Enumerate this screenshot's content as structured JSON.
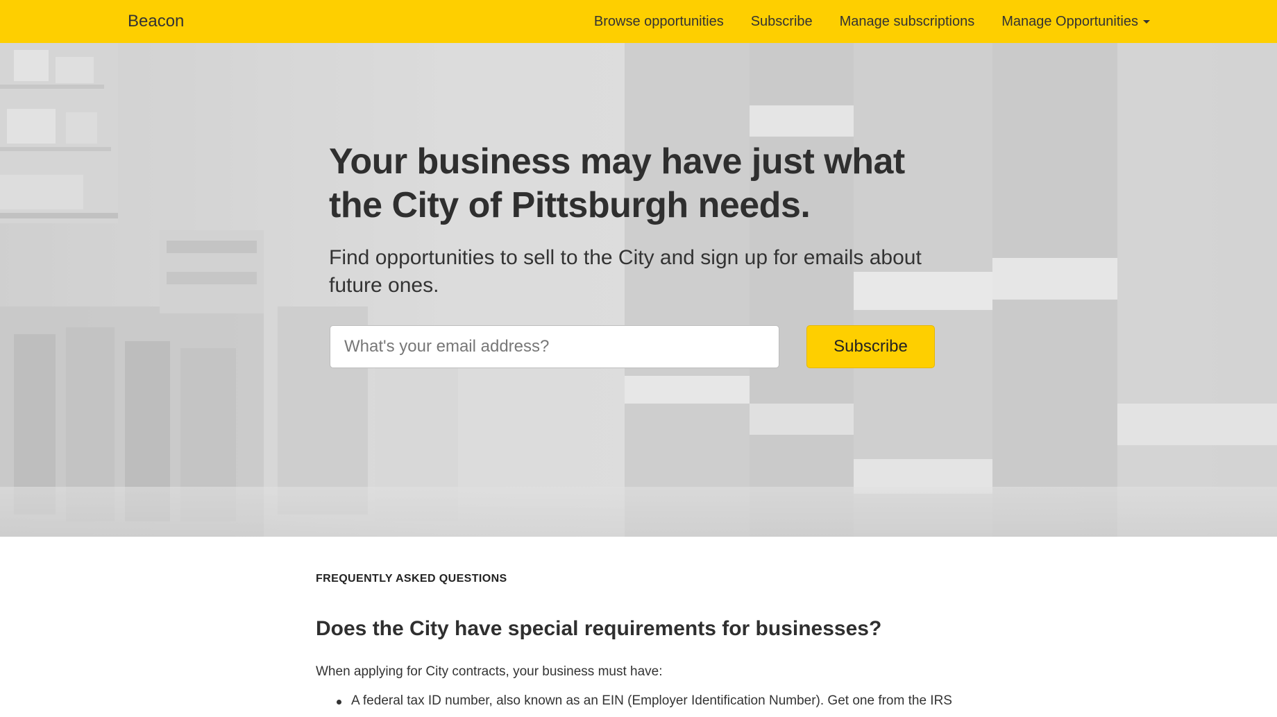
{
  "navbar": {
    "brand": "Beacon",
    "links": [
      {
        "label": "Browse opportunities"
      },
      {
        "label": "Subscribe"
      },
      {
        "label": "Manage subscriptions"
      },
      {
        "label": "Manage Opportunities",
        "icon": "caret-down-icon"
      }
    ],
    "background_color": "#fecf00"
  },
  "hero": {
    "title": "Your business may have just what the City of Pittsburgh needs.",
    "subtitle": "Find opportunities to sell to the City and sign up for emails about future ones.",
    "email_placeholder": "What's your email address?",
    "subscribe_label": "Subscribe",
    "accent_color": "#fecf00"
  },
  "faq": {
    "eyebrow": "FREQUENTLY ASKED QUESTIONS",
    "question": "Does the City have special requirements for businesses?",
    "intro": "When applying for City contracts, your business must have:",
    "items": [
      "A federal tax ID number, also known as an EIN (Employer Identification Number). Get one from the IRS"
    ]
  }
}
